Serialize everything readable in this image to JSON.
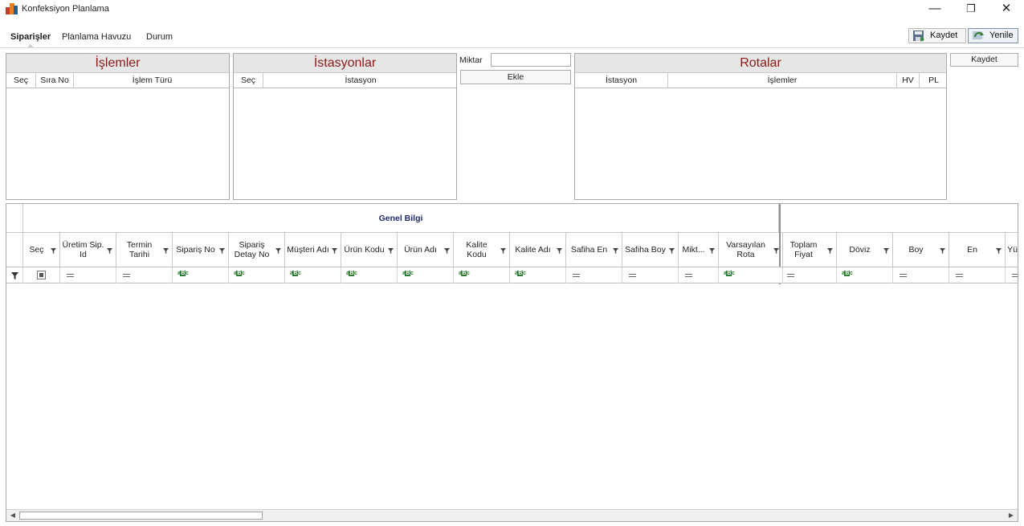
{
  "window": {
    "title": "Konfeksiyon Planlama",
    "controls": {
      "minimize": "—",
      "restore": "❐",
      "close": "✕"
    }
  },
  "tabs": [
    {
      "label": "Siparişler",
      "active": true
    },
    {
      "label": "Planlama Havuzu",
      "active": false
    },
    {
      "label": "Durum",
      "active": false
    }
  ],
  "toolbar": {
    "save_label": "Kaydet",
    "refresh_label": "Yenile"
  },
  "islemler": {
    "title": "İşlemler",
    "columns": [
      "Seç",
      "Sıra No",
      "İşlem Türü"
    ]
  },
  "istasyonlar": {
    "title": "İstasyonlar",
    "columns": [
      "Seç",
      "İstasyon"
    ]
  },
  "middle": {
    "miktar_label": "Miktar",
    "miktar_value": "",
    "ekle_label": "Ekle"
  },
  "rotalar": {
    "title": "Rotalar",
    "columns": [
      "İstasyon",
      "İşlemler",
      "HV",
      "PL"
    ],
    "save_label": "Kaydet"
  },
  "grid": {
    "band_label": "Genel Bilgi",
    "band2_label": "",
    "columns": [
      {
        "label": "Seç",
        "filter": "check"
      },
      {
        "label": "Üretim Sip. Id",
        "filter": "eq"
      },
      {
        "label": "Termin Tarihi",
        "filter": "eq"
      },
      {
        "label": "Sipariş No",
        "filter": "abc"
      },
      {
        "label": "Sipariş Detay No",
        "filter": "abc"
      },
      {
        "label": "Müşteri Adı",
        "filter": "abc"
      },
      {
        "label": "Ürün Kodu",
        "filter": "abc"
      },
      {
        "label": "Ürün Adı",
        "filter": "abc"
      },
      {
        "label": "Kalite Kodu",
        "filter": "abc"
      },
      {
        "label": "Kalite Adı",
        "filter": "abc"
      },
      {
        "label": "Safiha En",
        "filter": "eq"
      },
      {
        "label": "Safiha Boy",
        "filter": "eq"
      },
      {
        "label": "Mikt...",
        "filter": "eq"
      },
      {
        "label": "Varsayılan Rota",
        "filter": "abc"
      },
      {
        "label": "Toplam Fiyat",
        "filter": "eq"
      },
      {
        "label": "Döviz",
        "filter": "abc"
      },
      {
        "label": "Boy",
        "filter": "eq"
      },
      {
        "label": "En",
        "filter": "eq"
      },
      {
        "label": "Yü",
        "filter": "eq"
      }
    ]
  },
  "colors": {
    "panel_title": "#8b1a1a",
    "band_text": "#1f2a6b",
    "filter_text_icon": "#2e7d32"
  },
  "icons": [
    "app-logo",
    "minimize-icon",
    "restore-icon",
    "close-icon",
    "save-icon",
    "refresh-icon",
    "funnel-icon",
    "equals-icon",
    "abc-icon",
    "scroll-left-icon",
    "scroll-right-icon"
  ]
}
